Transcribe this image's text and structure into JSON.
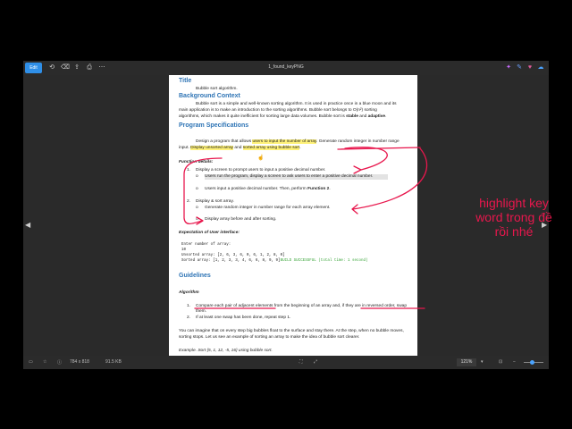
{
  "toolbar": {
    "edit_label": "Edit",
    "filename": "1_found_keyPNG"
  },
  "document": {
    "title_heading": "Title",
    "title_text": "Bubble sort algorithm.",
    "bg_heading": "Background Context",
    "bg_l1": "Bubble sort is a simple and well-known sorting algorithm. It is used in practice once in a blue moon and its",
    "bg_l2": "main application is to make an introduction to the sorting algorithms. Bubble sort belongs to O(n²) sorting",
    "bg_l3a": "algorithms, which makes it quite inefficient for sorting large data volumes. Bubble sort is ",
    "bg_stable": "stable",
    "bg_and": " and ",
    "bg_adaptive": "adaptive",
    "bg_end": ".",
    "spec_heading": "Program Specifications",
    "spec_p1a": "Design a program that allows ",
    "spec_p1b": "users to input the number of array",
    "spec_p1c": ". Generate random integer in number range",
    "spec_p2a": "input. ",
    "spec_p2b": "Display unsorted array",
    "spec_p2c": " and ",
    "spec_p2d": "sorted array using bubble sort",
    "spec_p2e": ".",
    "fd_heading": "Function details:",
    "fd_1_num": "1.",
    "fd_1": "Display a screen to prompt users to input a positive decimal number.",
    "fd_1a": "Users run the program, display a screen to ask users to enter a positive decimal number.",
    "fd_1b_pre": "Users input a positive decimal number. Then, perform ",
    "fd_1b_bold": "Function 2",
    "fd_1b_end": ".",
    "fd_2_num": "2.",
    "fd_2": "Display & sort array.",
    "fd_2a": "Generate random integer in number range for each array element.",
    "fd_2b": "Display array before and after sorting.",
    "exp_heading": "Expectation of User interface:",
    "ui_l1": "Enter number of array:",
    "ui_l2": "10",
    "ui_l3": "Unsorted array: [2, 6, 3, 6, 0, 6, 1, 2, 8, 0]",
    "ui_l4a": "Sorted array: [1, 2, 3, 3, 4, 6, 6, 8, 9, 9]",
    "ui_l4b": "BUILD SUCCESSFUL (total time: 1 second)",
    "guide_heading": "Guidelines",
    "algo_heading": "Algorithm",
    "g_1_num": "1.",
    "g_1a": "Compare each pair of adjacent elements",
    "g_1b": " from the beginning of an array and, if ",
    "g_1c": "they are in reversed order",
    "g_1d": ", swap",
    "g_1e": "them.",
    "g_2_num": "2.",
    "g_2": "If at least one swap has been done, repeat step 1.",
    "p_l1": "You can imagine that on every step big bubbles float to the surface and stay there. At the step, when no bubble moves,",
    "p_l2": "sorting stops. Let us see an example of sorting an array to make the idea of bubble sort clearer.",
    "ex_l": "Example. Sort {5, 1, 12, -5, 16} using bubble sort."
  },
  "statusbar": {
    "dimensions": "784 x 818",
    "filesize": "91.5 KB",
    "zoom": "121%"
  },
  "annotation": {
    "l1": "highlight key",
    "l2": "word trong đề",
    "l3": "rồi nhé"
  },
  "colors": {
    "accent": "#2f8fe8",
    "heading": "#2e74b5",
    "highlight": "#fff27a",
    "pen": "#e8174d"
  }
}
